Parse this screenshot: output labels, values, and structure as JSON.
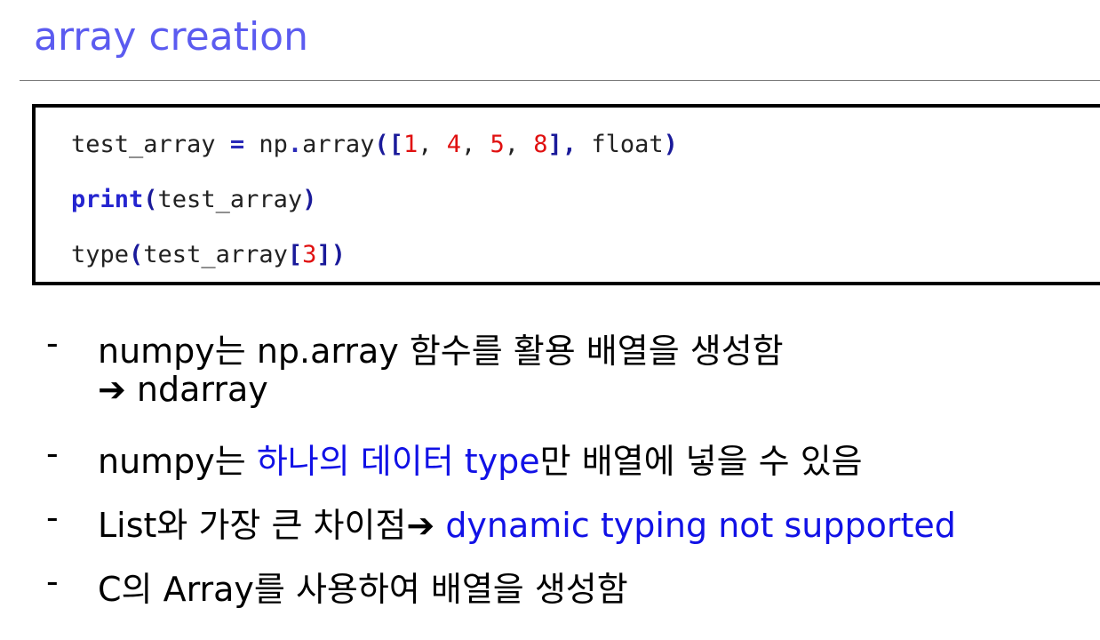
{
  "title": "array creation",
  "code": {
    "line1": {
      "var": "test_array",
      "eq": "=",
      "mod": "np",
      "dot": ".",
      "fn": "array",
      "open": "([",
      "n1": "1",
      "n2": "4",
      "n3": "5",
      "n4": "8",
      "sep": ", ",
      "close_list": "],",
      "arg": " float",
      "close": ")"
    },
    "line2": {
      "kw": "print",
      "open": "(",
      "arg": "test_array",
      "close": ")"
    },
    "line3": {
      "fn": "type",
      "open": "(",
      "arg": "test_array",
      "lb": "[",
      "idx": "3",
      "rb": "])"
    }
  },
  "bullets": {
    "dash": "-",
    "b1": "numpy는 np.array 함수를 활용 배열을 생성함",
    "b1_cont": "➔ ndarray",
    "b2_pre": "numpy는 ",
    "b2_blue": "하나의 데이터 type",
    "b2_post": "만 배열에 넣을 수 있음",
    "b3_pre": "List와 가장 큰 차이점➔ ",
    "b3_blue": "dynamic typing not supported",
    "b4": "C의 Array를 사용하여 배열을 생성함"
  },
  "colors": {
    "title": "#5b5bf0",
    "highlight": "#1111e6",
    "number": "#e01010",
    "keyword": "#2525d0"
  }
}
